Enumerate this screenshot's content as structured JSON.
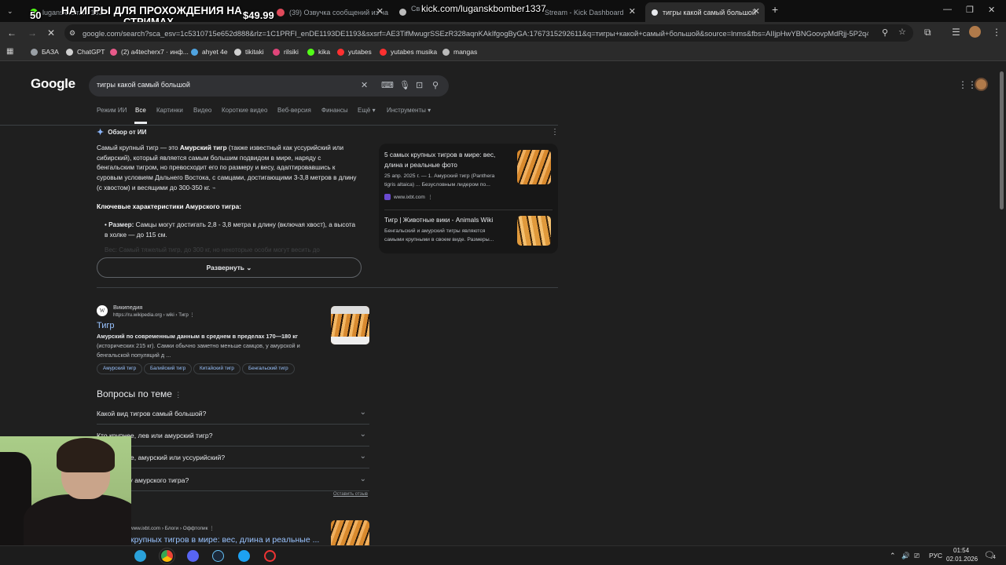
{
  "tabs": [
    {
      "title": "luganskbomber1337",
      "active": false
    },
    {
      "title": "(39) Озвучка сообщений из ча",
      "active": false
    },
    {
      "title": "Stream - Kick Dashboard",
      "active": false
    },
    {
      "title": "тигры какой самый большой",
      "active": true
    }
  ],
  "overlay": {
    "line1": "НА ИГРЫ ДЛЯ ПРОХОЖДЕНИЯ НА",
    "line2": "СТРИМАХ",
    "left_amount": "50",
    "price": "$49.99",
    "channel_url": "kick.com/luganskbomber1337",
    "tab_partial": "Св"
  },
  "toolbar": {
    "url": "google.com/search?sca_esv=1c5310715e652d888&rlz=1C1PRFI_enDE1193DE1193&sxsrf=AE3TifMwugrSSEzR328aqnKAkIfgogByGA:1767315292611&q=тигры+какой+самый+большой&source=lnms&fbs=AIIjpHwYBNGoovpMdRjj-5P2q4UuXq..."
  },
  "bookmarks": [
    {
      "label": "БАЗА",
      "color": "#9aa0a6"
    },
    {
      "label": "ChatGPT",
      "color": "#d0d0d0"
    },
    {
      "label": "(2) a4techerx7 · инф...",
      "color": "#e85a8a"
    },
    {
      "label": "ahyet 4e",
      "color": "#4fa3e0"
    },
    {
      "label": "tikitaki",
      "color": "#d0d0d0"
    },
    {
      "label": "rilsiki",
      "color": "#e0457a"
    },
    {
      "label": "kika",
      "color": "#53fc18"
    },
    {
      "label": "yutabes",
      "color": "#ff3030"
    },
    {
      "label": "yutabes musika",
      "color": "#ff3030"
    },
    {
      "label": "mangas",
      "color": "#bbbbbb"
    }
  ],
  "google": {
    "logo": "Google",
    "query": "тигры какой самый большой",
    "nav_tabs": [
      "Режим ИИ",
      "Все",
      "Картинки",
      "Видео",
      "Короткие видео",
      "Веб-версия",
      "Финансы",
      "Ещё",
      "Инструменты"
    ],
    "active_tab": "Все"
  },
  "ai_overview": {
    "heading": "Обзор от ИИ",
    "p_pre": "Самый крупный тигр — это ",
    "p_bold": "Амурский тигр",
    "p_post": " (также известный как уссурийский или сибирский), который является самым большим подвидом в мире, наряду с бенгальским тигром, но превосходит его по размеру и весу, адаптировавшись к суровым условиям Дальнего Востока, с самцами, достигающими 3-3,8 метров в длину (с хвостом) и весящими до 300-350 кг.",
    "subheading": "Ключевые характеристики Амурского тигра:",
    "bullet_label": "Размер:",
    "bullet_text": " Самцы могут достигать 2,8 - 3,8 метра в длину (включая хвост), а высота в холке — до 115 см.",
    "faded_text": "Вес: Самый тяжелый тигр, до 300 кг, но некоторые особи могут весить до",
    "expand_label": "Развернуть"
  },
  "sources": [
    {
      "title": "5 самых крупных тигров в мире: вес, длина и реальные фото",
      "snippet_date": "25 апр. 2025 г. — 1. Амурский тигр (Panthera tigris altaica) ... Безусловным лидером по...",
      "site": "www.ixbt.com"
    },
    {
      "title": "Тигр | Животные вики - Animals Wiki",
      "snippet": "Бенгальский и амурский тигры являются самыми крупными в своем виде. Размеры..."
    }
  ],
  "wiki": {
    "site_name": "Википедия",
    "cite": "https://ru.wikipedia.org › wiki › Тигр",
    "title": "Тигр",
    "snippet_bold": "Амурский по современным данным в среднем в пределах 170—180 кг",
    "snippet_rest": " (исторических 215 кг). Самки обычно заметно меньше самцов, у амурской и бенгальской популяций д ...",
    "chips": [
      "Амурский тигр",
      "Балийский тигр",
      "Китайский тигр",
      "Бенгальский тигр"
    ]
  },
  "paa": {
    "heading": "Вопросы по теме",
    "questions": [
      "Какой вид тигров самый большой?",
      "Кто крупнее, лев или амурский тигр?",
      "Кто крупнее, амурский или уссурийский?",
      "Какой вес у амурского тигра?"
    ],
    "feedback": "Оставить отзыв"
  },
  "ixbt_result": {
    "cite": "www.ixbt.com › Блоги › Оффтопик",
    "title": "крупных тигров в мире: вес, длина и реальные ..."
  },
  "taskbar": {
    "lang": "РУС",
    "time": "01:54",
    "date": "02.01.2026",
    "notif_count": "4"
  }
}
